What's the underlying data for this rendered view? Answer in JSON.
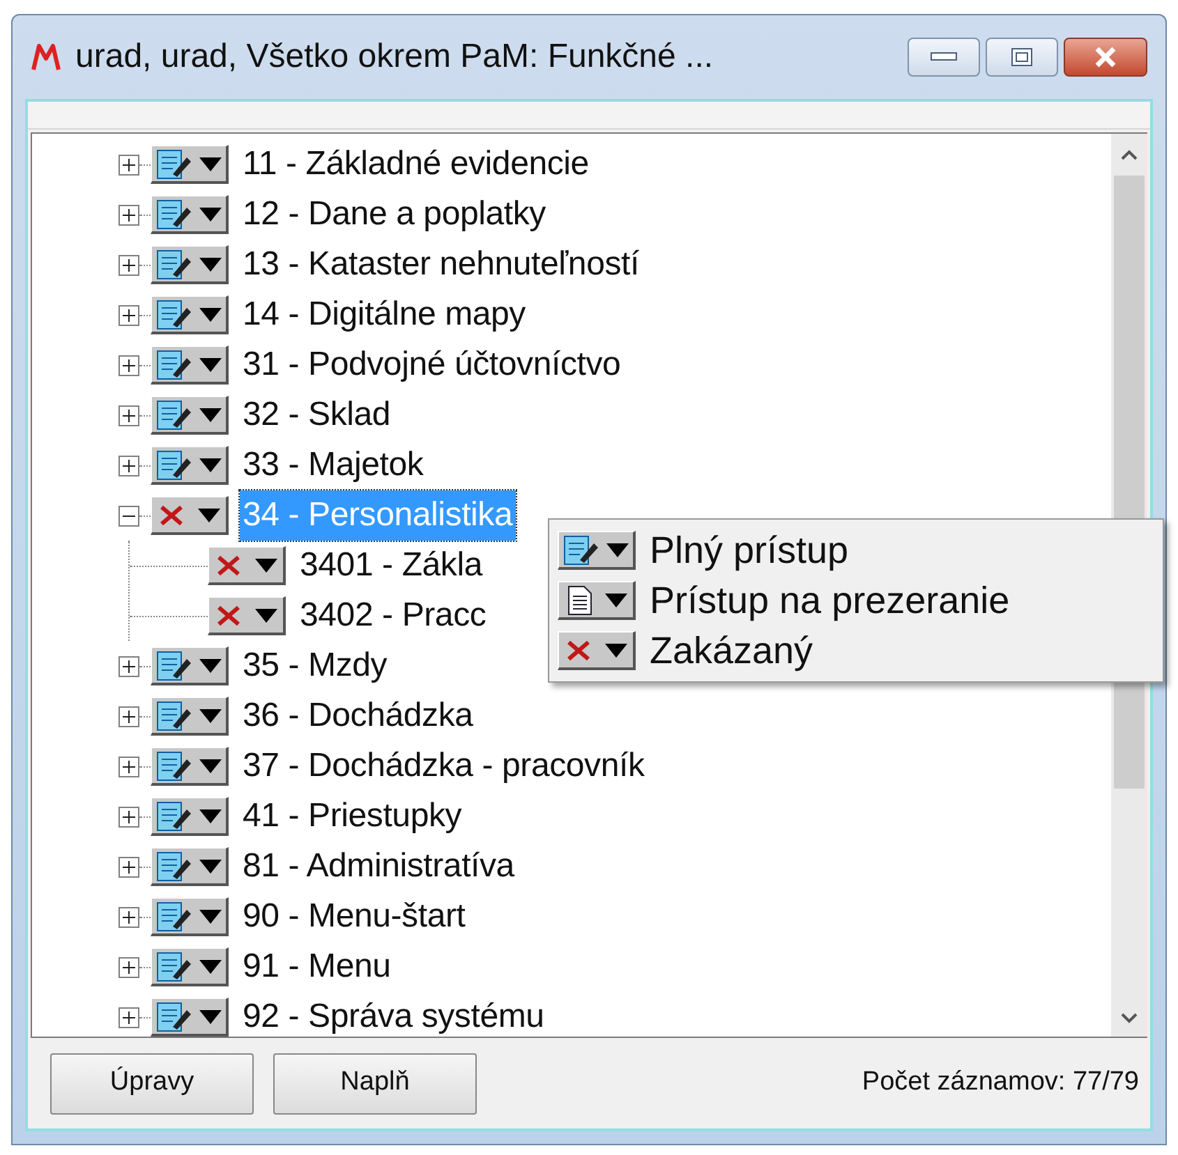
{
  "window": {
    "title": "urad, urad, Všetko okrem PaM:  Funkčné ..."
  },
  "tree": [
    {
      "label": "11 - Základné evidencie",
      "kind": "full",
      "expanded": false,
      "selected": false
    },
    {
      "label": "12 - Dane a poplatky",
      "kind": "full",
      "expanded": false,
      "selected": false
    },
    {
      "label": "13 - Kataster nehnuteľností",
      "kind": "full",
      "expanded": false,
      "selected": false
    },
    {
      "label": "14 - Digitálne mapy",
      "kind": "full",
      "expanded": false,
      "selected": false
    },
    {
      "label": "31 - Podvojné účtovníctvo",
      "kind": "full",
      "expanded": false,
      "selected": false
    },
    {
      "label": "32 - Sklad",
      "kind": "full",
      "expanded": false,
      "selected": false
    },
    {
      "label": "33 - Majetok",
      "kind": "full",
      "expanded": false,
      "selected": false
    },
    {
      "label": "34 - Personalistika",
      "kind": "denied",
      "expanded": true,
      "selected": true,
      "children": [
        {
          "label": "3401 - Zákla",
          "kind": "denied",
          "selected": false
        },
        {
          "label": "3402 - Pracc",
          "kind": "denied",
          "selected": false
        }
      ]
    },
    {
      "label": "35 - Mzdy",
      "kind": "full",
      "expanded": false,
      "selected": false
    },
    {
      "label": "36 - Dochádzka",
      "kind": "full",
      "expanded": false,
      "selected": false
    },
    {
      "label": "37 - Dochádzka - pracovník",
      "kind": "full",
      "expanded": false,
      "selected": false
    },
    {
      "label": "41 - Priestupky",
      "kind": "full",
      "expanded": false,
      "selected": false
    },
    {
      "label": "81 - Administratíva",
      "kind": "full",
      "expanded": false,
      "selected": false
    },
    {
      "label": "90 - Menu-štart",
      "kind": "full",
      "expanded": false,
      "selected": false
    },
    {
      "label": "91 - Menu",
      "kind": "full",
      "expanded": false,
      "selected": false
    },
    {
      "label": "92 - Správa systému",
      "kind": "full",
      "expanded": false,
      "selected": false
    }
  ],
  "access_menu": [
    {
      "kind": "full",
      "label": "Plný prístup"
    },
    {
      "kind": "view",
      "label": "Prístup na prezeranie"
    },
    {
      "kind": "denied",
      "label": "Zakázaný"
    }
  ],
  "buttons": [
    "Úpravy",
    "Naplň"
  ],
  "record_count": "Počet záznamov: 77/79"
}
